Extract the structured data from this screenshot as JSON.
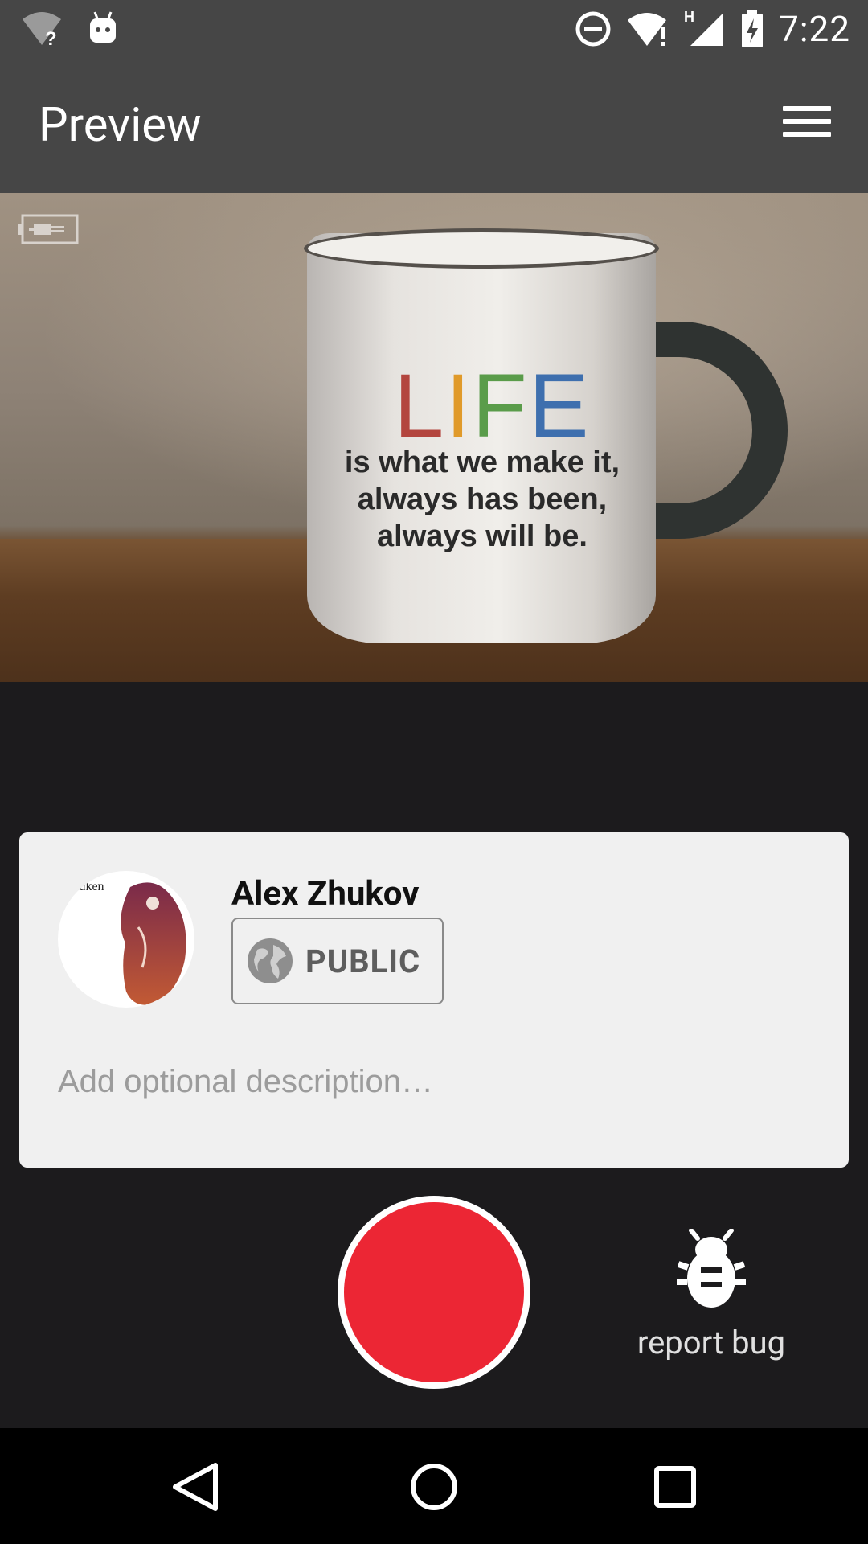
{
  "status_bar": {
    "time": "7:22",
    "icons": [
      "wifi-unknown-icon",
      "android-debug-icon",
      "do-not-disturb-icon",
      "wifi-alert-icon",
      "cell-signal-h-icon",
      "battery-charging-icon"
    ]
  },
  "app_bar": {
    "title": "Preview",
    "menu_icon": "hamburger-menu-icon"
  },
  "preview": {
    "mug_life_letters": [
      "L",
      "I",
      "F",
      "E"
    ],
    "mug_quote": "is what we make it, always has been, always will be.",
    "indicator_icon": "battery-plug-icon"
  },
  "card": {
    "user_name": "Alex Zhukov",
    "avatar_icon": "user-avatar",
    "avatar_text": "ıuken",
    "visibility_label": "PUBLIC",
    "visibility_icon": "globe-icon",
    "description_placeholder": "Add optional description…",
    "description_value": ""
  },
  "controls": {
    "record_icon": "record-icon",
    "report_bug_label": "report bug",
    "report_bug_icon": "bug-icon"
  },
  "nav_bar": {
    "back_icon": "back-triangle-icon",
    "home_icon": "home-circle-icon",
    "recents_icon": "recents-square-icon"
  },
  "colors": {
    "bar_bg": "#464646",
    "screen_bg": "#1c1b1d",
    "card_bg": "#f0f0f0",
    "record_red": "#ec2634"
  }
}
